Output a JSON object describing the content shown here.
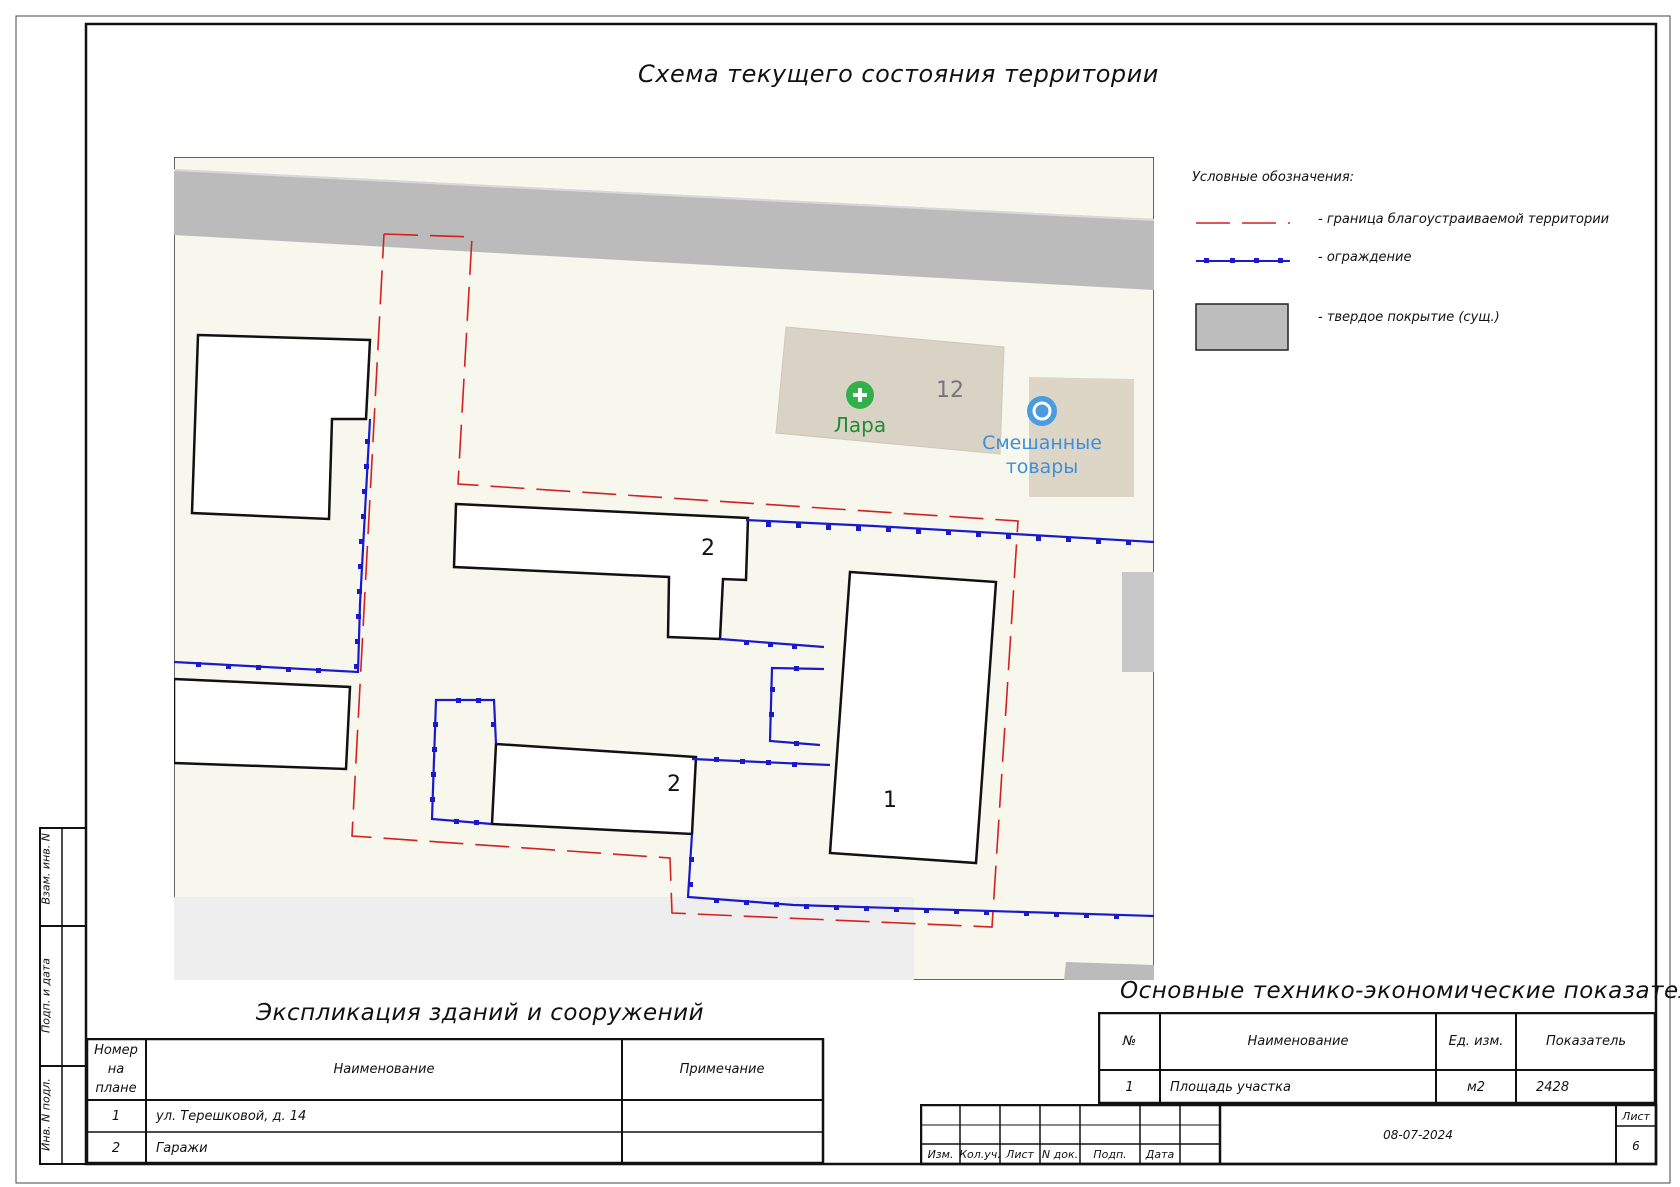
{
  "sheet_title": "Схема текущего состояния территории",
  "legend": {
    "title": "Условные обозначения:",
    "items": [
      {
        "line": "red-dash",
        "label": "- граница благоустраиваемой территории"
      },
      {
        "line": "blue-fence",
        "label": "- ограждение"
      },
      {
        "line": "gray-fill",
        "label": "- твердое покрытие (сущ.)"
      }
    ]
  },
  "map": {
    "poi_pharmacy": "Лара",
    "poi_house_number": "12",
    "poi_shop_line1": "Смешанные",
    "poi_shop_line2": "товары",
    "building_labels": [
      "2",
      "2",
      "1"
    ]
  },
  "explication": {
    "title": "Экспликация зданий и сооружений",
    "headers": {
      "number_line1": "Номер",
      "number_line2": "на",
      "number_line3": "плане",
      "name": "Наименование",
      "note": "Примечание"
    },
    "rows": [
      {
        "num": "1",
        "name": "ул. Терешковой, д. 14",
        "note": ""
      },
      {
        "num": "2",
        "name": "Гаражи",
        "note": ""
      }
    ]
  },
  "indicators": {
    "title": "Основные технико-экономические показатели",
    "headers": {
      "num": "№",
      "name": "Наименование",
      "unit": "Ед. изм.",
      "value": "Показатель"
    },
    "rows": [
      {
        "num": "1",
        "name": "Площадь участка",
        "unit": "м2",
        "value": "2428"
      }
    ]
  },
  "stamp": {
    "cols": [
      "Изм.",
      "Кол.уч.",
      "Лист",
      "N док.",
      "Подп.",
      "Дата"
    ],
    "date": "08-07-2024",
    "sheet_label": "Лист",
    "sheet_number": "6"
  },
  "side_labels": {
    "vzam": "Взам. инв. N",
    "podp": "Подп. и дата",
    "inv": "Инв. N подл."
  },
  "colors": {
    "frame": "#111111",
    "boundary": "#d42020",
    "fence": "#1a1acc",
    "paving": "#bdbdbd",
    "map_bg": "#f7f7ee"
  }
}
